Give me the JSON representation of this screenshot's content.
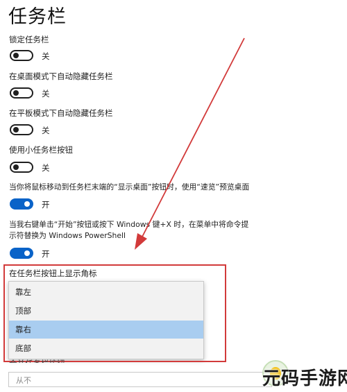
{
  "page": {
    "title": "任务栏"
  },
  "settings": [
    {
      "label": "锁定任务栏",
      "state": "关",
      "on": false
    },
    {
      "label": "在桌面模式下自动隐藏任务栏",
      "state": "关",
      "on": false
    },
    {
      "label": "在平板模式下自动隐藏任务栏",
      "state": "关",
      "on": false
    },
    {
      "label": "使用小任务栏按钮",
      "state": "关",
      "on": false
    },
    {
      "label": "当你将鼠标移动到任务栏末端的“显示桌面”按钮时，使用“速览”预览桌面",
      "state": "开",
      "on": true
    },
    {
      "label_line1": "当我右键单击“开始”按钮或按下 Windows 键+X 时，在菜单中将命令提",
      "label_line2": "示符替换为 Windows PowerShell",
      "state": "开",
      "on": true
    }
  ],
  "badge_position": {
    "label": "在任务栏按钮上显示角标",
    "options": [
      "靠左",
      "顶部",
      "靠右",
      "底部"
    ],
    "selected_index": 2
  },
  "next_setting": {
    "partial_label": "合并任务栏按钮",
    "value": "从不"
  },
  "watermark": {
    "text": "元码手游网"
  },
  "colors": {
    "toggle_on": "#0a63c8",
    "highlight_border": "#d23a3a",
    "arrow": "#d23a3a",
    "selected_option": "#a9cdf0"
  },
  "icons": {
    "arrow": "annotation-arrow",
    "logo": "watermark-logo-icon"
  }
}
